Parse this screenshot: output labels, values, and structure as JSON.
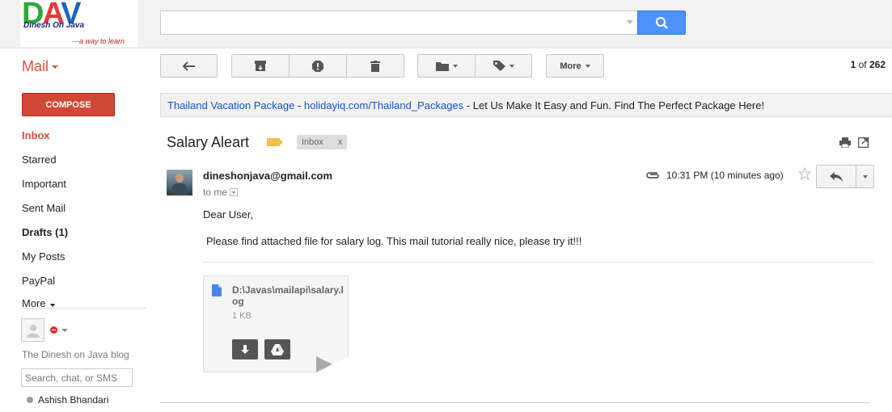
{
  "logo": {
    "letters": "DAV",
    "line1": "Dinesh On Java",
    "line2": "---a way to learn"
  },
  "search": {
    "value": "",
    "placeholder": ""
  },
  "mail_menu_label": "Mail",
  "toolbar": {
    "more_label": "More"
  },
  "pager": {
    "current": "1",
    "of": "of",
    "total": "262"
  },
  "compose_label": "COMPOSE",
  "nav": {
    "items": [
      {
        "label": "Inbox",
        "state": "active"
      },
      {
        "label": "Starred",
        "state": ""
      },
      {
        "label": "Important",
        "state": ""
      },
      {
        "label": "Sent Mail",
        "state": ""
      },
      {
        "label": "Drafts (1)",
        "state": "bold"
      },
      {
        "label": "My Posts",
        "state": ""
      },
      {
        "label": "PayPal",
        "state": ""
      }
    ],
    "more_label": "More"
  },
  "chat": {
    "status_color": "#e02b2b",
    "blog_text": "The Dinesh on Java blog",
    "search_placeholder": "Search, chat, or SMS",
    "contact_name": "Ashish Bhandari"
  },
  "ad": {
    "title": "Thailand Vacation Package",
    "sep1": " - ",
    "url": "holidayiq.com/Thailand_Packages",
    "sep2": " - ",
    "text": "Let Us Make It Easy and Fun. Find The Perfect Package Here!"
  },
  "message": {
    "subject": "Salary Aleart",
    "label": "Inbox",
    "label_remove": "x",
    "sender": "dineshonjava@gmail.com",
    "to": "to me",
    "time": "10:31 PM (10 minutes ago)",
    "greeting": "Dear User,",
    "body": "Please find attached file for salary log. This mail tutorial really nice, please try it!!!",
    "attachment": {
      "name": "D:\\Javas\\mailapi\\salary.log",
      "size": "1 KB"
    }
  },
  "colors": {
    "accent_red": "#dd4b39",
    "compose_bg": "#d14836",
    "search_blue": "#4d90fe",
    "link": "#1155cc",
    "label_yellow": "#f0c14b"
  }
}
